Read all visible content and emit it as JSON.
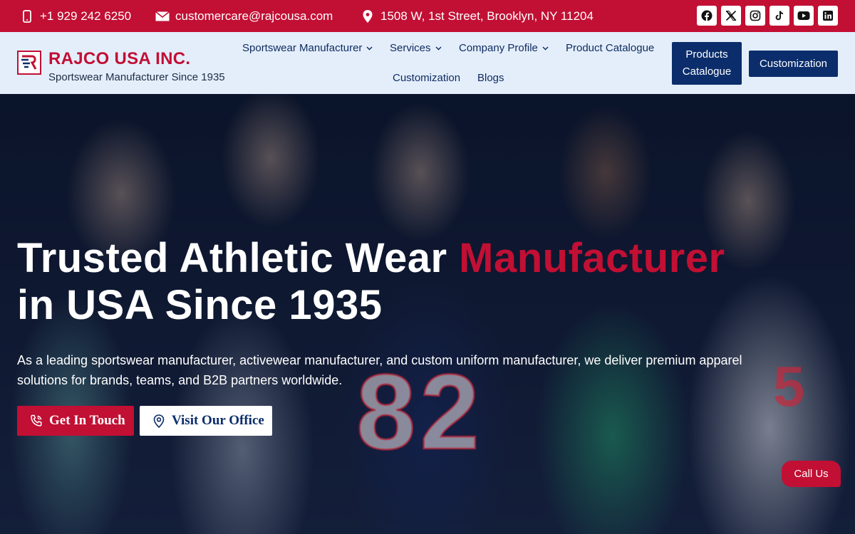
{
  "topbar": {
    "phone": "+1 929 242 6250",
    "email": "customercare@rajcousa.com",
    "address": "1508 W, 1st Street, Brooklyn, NY 11204",
    "socials": [
      "facebook-icon",
      "x-icon",
      "instagram-icon",
      "tiktok-icon",
      "youtube-icon",
      "linkedin-icon"
    ]
  },
  "header": {
    "brand_name": "RAJCO USA INC.",
    "tagline": "Sportswear Manufacturer Since 1935"
  },
  "nav": {
    "sportswear": "Sportswear Manufacturer",
    "services": "Services",
    "company": "Company Profile",
    "product_catalogue": "Product Catalogue",
    "customization": "Customization",
    "blogs": "Blogs",
    "btn_products_catalogue": "Products Catalogue",
    "btn_customization": "Customization"
  },
  "hero": {
    "headline_part1": "Trusted Athletic Wear ",
    "headline_accent": "Manufacturer",
    "headline_part2": "in USA Since 1935",
    "subtext": "As a leading sportswear manufacturer, activewear manufacturer, and custom uniform manufacturer, we deliver premium apparel solutions for brands, teams, and B2B partners worldwide.",
    "cta_primary": "Get In Touch",
    "cta_secondary": "Visit Our Office",
    "jersey_number": "82",
    "jersey_number_2": "5"
  },
  "floating": {
    "call_us": "Call Us"
  },
  "colors": {
    "brand_red": "#c20f34",
    "brand_navy": "#0b2d6b",
    "nav_bg": "#e4eefb"
  }
}
